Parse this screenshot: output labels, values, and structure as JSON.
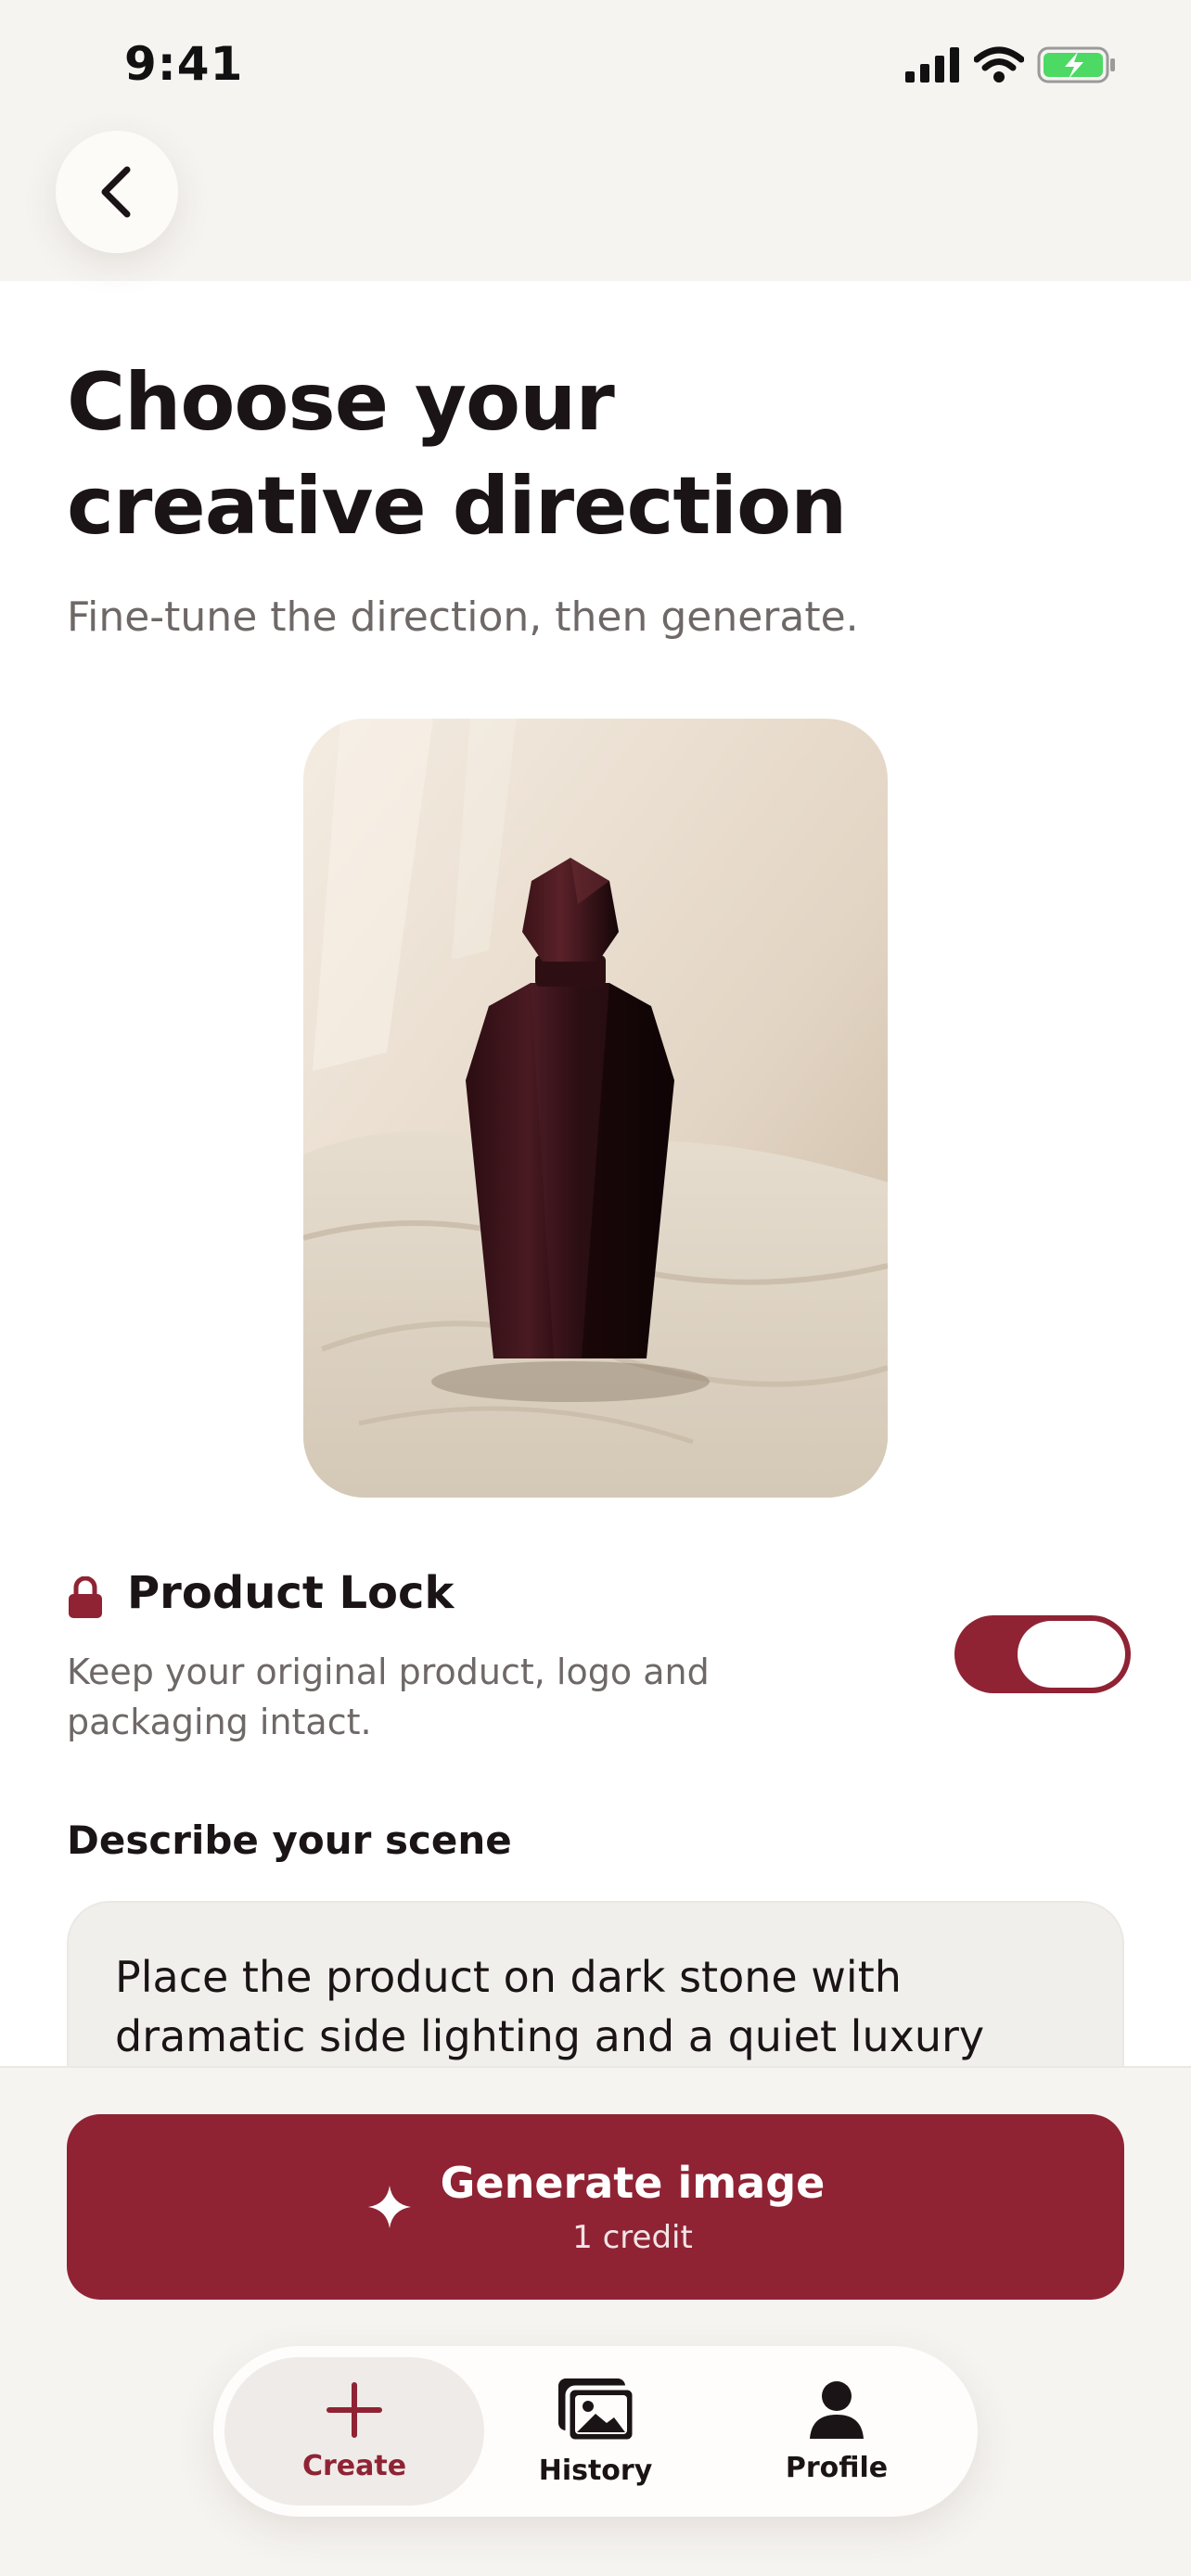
{
  "status_bar": {
    "time": "9:41"
  },
  "header": {
    "title_line1": "Choose your",
    "title_line2": "creative direction",
    "subtitle": "Fine-tune the direction, then generate."
  },
  "product_lock": {
    "title": "Product Lock",
    "description": "Keep your original product, logo and packaging intact.",
    "enabled": true
  },
  "scene": {
    "label": "Describe your scene",
    "text": "Place the product on dark stone with dramatic side lighting and a quiet luxury"
  },
  "generate": {
    "label": "Generate image",
    "cost": "1 credit"
  },
  "tabs": [
    {
      "label": "Create",
      "icon": "plus-icon",
      "active": true
    },
    {
      "label": "History",
      "icon": "gallery-icon",
      "active": false
    },
    {
      "label": "Profile",
      "icon": "person-icon",
      "active": false
    }
  ],
  "colors": {
    "accent": "#8f2334",
    "background": "#f6f4f1",
    "text": "#1b1416",
    "muted": "#6e6867"
  }
}
